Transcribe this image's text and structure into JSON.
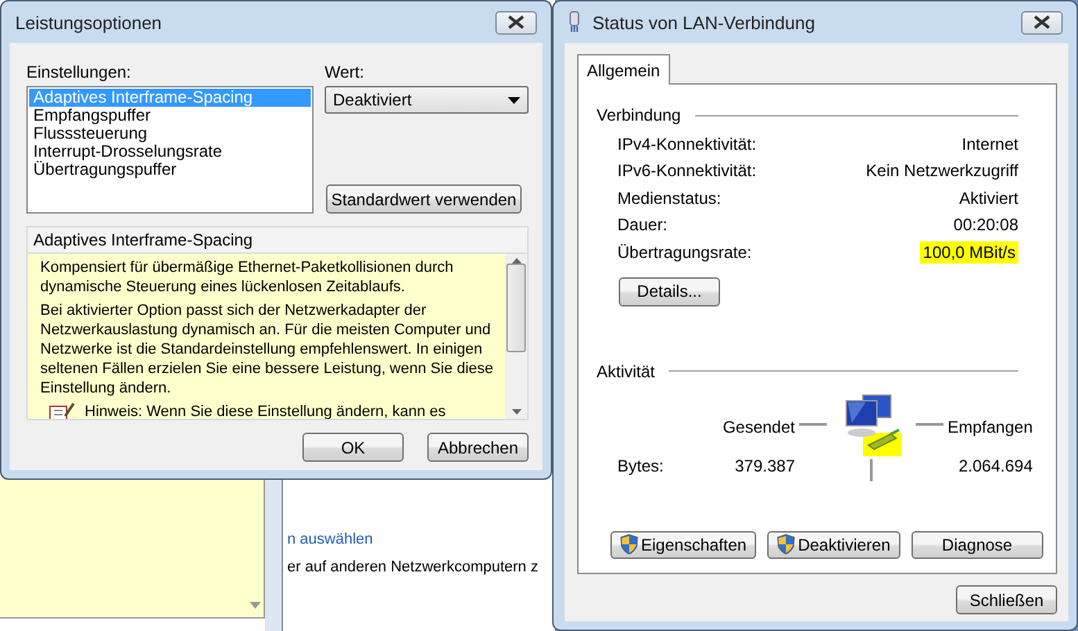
{
  "background_window": {
    "link": "n auswählen",
    "text": "er auf anderen Netzwerkcomputern z"
  },
  "performance_dialog": {
    "title": "Leistungsoptionen",
    "settings_label": "Einstellungen:",
    "settings": [
      {
        "label": "Adaptives Interframe-Spacing",
        "selected": true
      },
      {
        "label": "Empfangspuffer",
        "selected": false
      },
      {
        "label": "Flusssteuerung",
        "selected": false
      },
      {
        "label": "Interrupt-Drosselungsrate",
        "selected": false
      },
      {
        "label": "Übertragungspuffer",
        "selected": false
      }
    ],
    "value_label": "Wert:",
    "value": "Deaktiviert",
    "default_button": "Standardwert verwenden",
    "description_title": "Adaptives Interframe-Spacing",
    "description_paragraphs": [
      "Kompensiert für übermäßige Ethernet-Paketkollisionen durch dynamische Steuerung eines lückenlosen Zeitablaufs.",
      "Bei aktivierter Option passt sich der Netzwerkadapter der Netzwerkauslastung dynamisch an. Für die meisten Computer und Netzwerke ist die Standardeinstellung empfehlenswert. In einigen seltenen Fällen erzielen Sie eine bessere Leistung, wenn Sie diese Einstellung ändern."
    ],
    "hint": "Hinweis: Wenn Sie diese Einstellung ändern, kann es",
    "buttons": [
      "OK",
      "Abbrechen"
    ]
  },
  "status_dialog": {
    "title": "Status von LAN-Verbindung",
    "tabs": [
      {
        "label": "Allgemein",
        "selected": true
      }
    ],
    "connection_heading": "Verbindung",
    "connection_rows": [
      {
        "label": "IPv4-Konnektivität:",
        "value": "Internet",
        "highlighted": false
      },
      {
        "label": "IPv6-Konnektivität:",
        "value": "Kein Netzwerkzugriff",
        "highlighted": false
      },
      {
        "label": "Medienstatus:",
        "value": "Aktiviert",
        "highlighted": false
      },
      {
        "label": "Dauer:",
        "value": "00:20:08",
        "highlighted": false
      },
      {
        "label": "Übertragungsrate:",
        "value": "100,0 MBit/s",
        "highlighted": true
      }
    ],
    "details_button": "Details...",
    "activity_heading": "Aktivität",
    "sent_label": "Gesendet",
    "received_label": "Empfangen",
    "bytes_label": "Bytes:",
    "bytes_sent": "379.387",
    "bytes_received": "2.064.694",
    "network_icon_highlighted": true,
    "buttons": [
      {
        "label": "Eigenschaften",
        "shield": true
      },
      {
        "label": "Deaktivieren",
        "shield": true
      },
      {
        "label": "Diagnose",
        "shield": false
      }
    ],
    "close_button": "Schließen"
  }
}
